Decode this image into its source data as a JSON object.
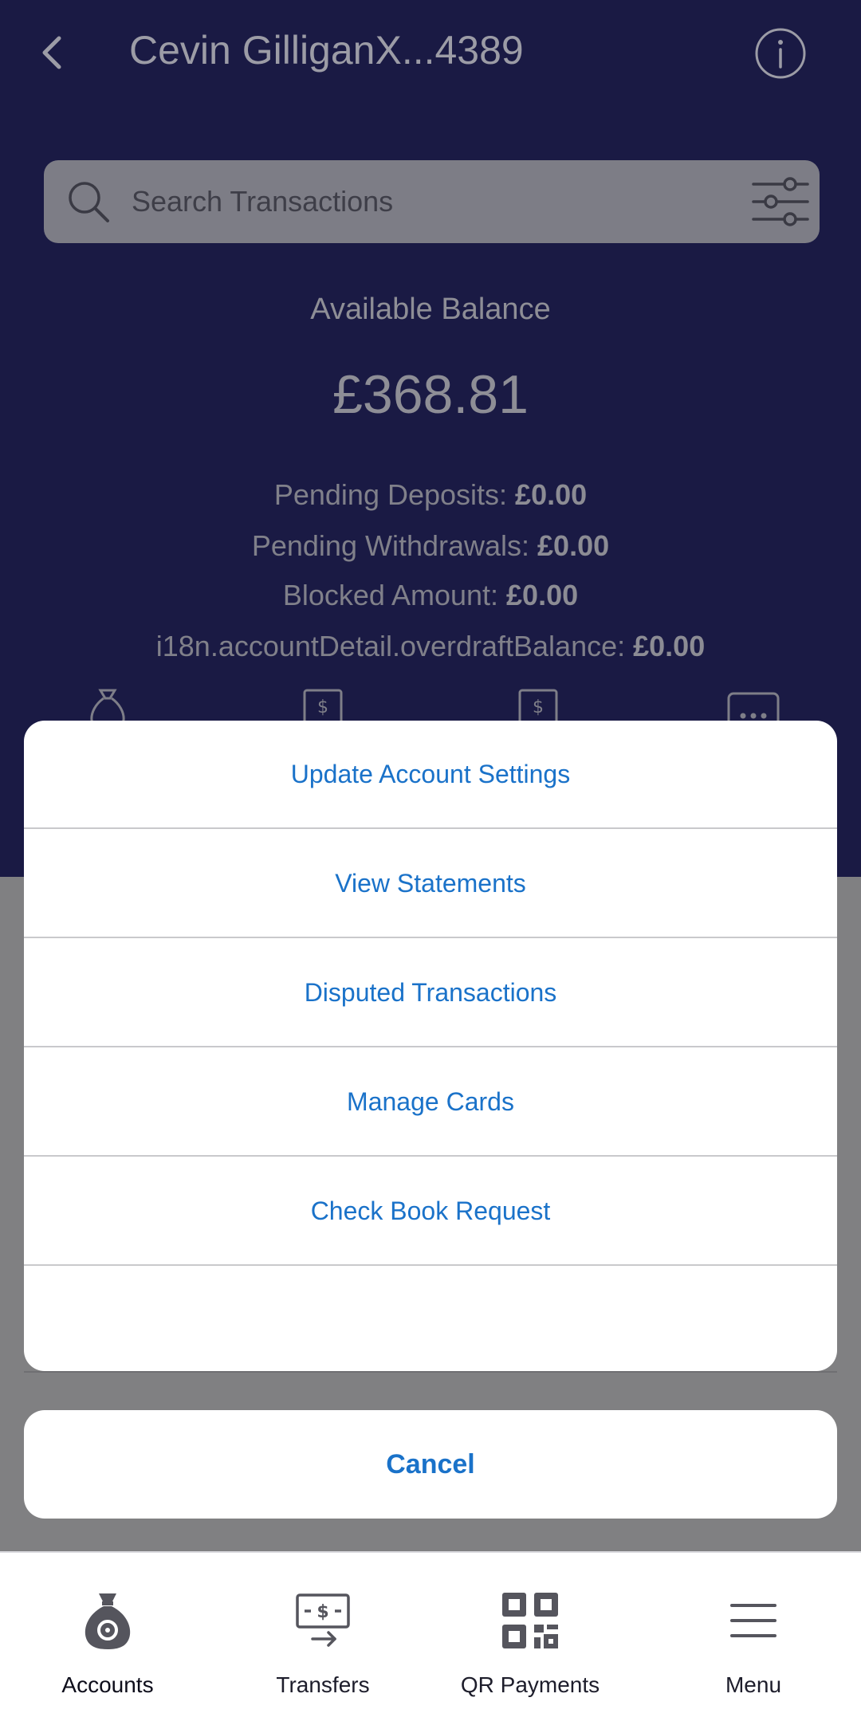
{
  "header": {
    "title": "Cevin GilliganX...4389"
  },
  "search": {
    "placeholder": "Search Transactions"
  },
  "balance": {
    "label": "Available Balance",
    "amount": "£368.81"
  },
  "details": [
    {
      "label": "Pending Deposits: ",
      "value": "£0.00"
    },
    {
      "label": "Pending Withdrawals: ",
      "value": "£0.00"
    },
    {
      "label": "Blocked Amount: ",
      "value": "£0.00"
    },
    {
      "label": "i18n.accountDetail.overdraftBalance: ",
      "value": "£0.00"
    }
  ],
  "action_sheet": {
    "items": [
      "Update Account Settings",
      "View Statements",
      "Disputed Transactions",
      "Manage Cards",
      "Check Book Request",
      ""
    ],
    "cancel": "Cancel"
  },
  "bottom_nav": {
    "items": [
      {
        "label": "Accounts",
        "icon": "money-bag-icon",
        "active": true
      },
      {
        "label": "Transfers",
        "icon": "transfer-icon",
        "active": false
      },
      {
        "label": "QR Payments",
        "icon": "qr-code-icon",
        "active": false
      },
      {
        "label": "Menu",
        "icon": "hamburger-menu-icon",
        "active": false
      }
    ]
  },
  "colors": {
    "header_bg": "#1a1a44",
    "overlay_bg": "#808082",
    "sheet_text": "#1a72c9",
    "sheet_bg": "#ffffff"
  }
}
